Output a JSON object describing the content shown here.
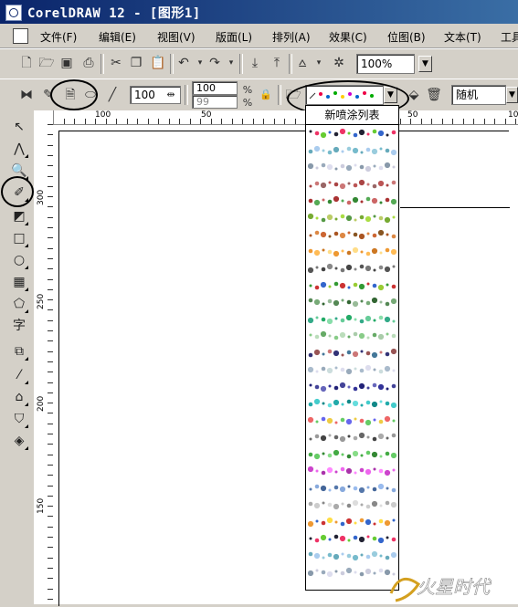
{
  "window": {
    "title": "CorelDRAW 12 - [图形1]"
  },
  "menu": {
    "items": [
      "文件(F)",
      "编辑(E)",
      "视图(V)",
      "版面(L)",
      "排列(A)",
      "效果(C)",
      "位图(B)",
      "文本(T)",
      "工具"
    ]
  },
  "toolbar1": {
    "zoom_value": "100%",
    "icons": [
      "new-icon",
      "open-icon",
      "save-icon",
      "print-icon",
      "cut-icon",
      "copy-icon",
      "paste-icon",
      "undo-icon",
      "redo-icon",
      "import-icon",
      "export-icon",
      "app-launcher-icon",
      "corel-online-icon"
    ]
  },
  "toolbar2": {
    "size_value": "100",
    "spray_amount_top": "100",
    "spray_amount_bottom": "99",
    "order_value": "随机"
  },
  "ruler": {
    "h_labels": [
      "100",
      "50",
      "0",
      "50",
      "10"
    ],
    "v_labels": [
      "300",
      "250",
      "200",
      "150"
    ]
  },
  "spray_list": {
    "header": "新喷涂列表",
    "row_count": 27
  },
  "colors": {
    "titlebar": "#0a246a",
    "chrome": "#d4d0c8",
    "canvas": "#ffffff"
  }
}
